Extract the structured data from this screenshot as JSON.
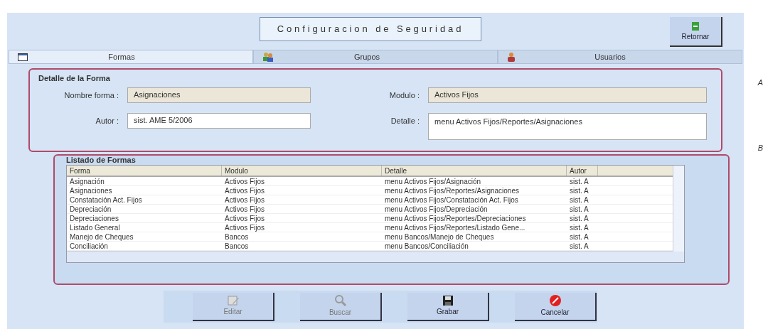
{
  "header": {
    "title": "Configuracion de Seguridad",
    "return_button": "Retornar"
  },
  "tabs": [
    {
      "label": "Formas",
      "selected": true,
      "kind": "form"
    },
    {
      "label": "Grupos",
      "selected": false,
      "kind": "group"
    },
    {
      "label": "Usuarios",
      "selected": false,
      "kind": "user"
    }
  ],
  "detail": {
    "title": "Detalle de la Forma",
    "fields": [
      {
        "label": "Nombre forma :",
        "value": "Asignaciones",
        "disabled": true
      },
      {
        "label": "Modulo :",
        "value": "Activos Fijos",
        "disabled": true
      },
      {
        "label": "Autor :",
        "value": "sist. AME 5/2006",
        "disabled": false
      },
      {
        "label": "Detalle :",
        "value": "menu Activos Fijos/Reportes/Asignaciones",
        "disabled": false
      }
    ]
  },
  "listing": {
    "title": "Listado de Formas",
    "columns": [
      "Forma",
      "Modulo",
      "Detalle",
      "Autor"
    ],
    "rows": [
      [
        "Asignación",
        "Activos Fijos",
        "menu Activos Fijos/Asignación",
        "sist. A"
      ],
      [
        "Asignaciones",
        "Activos Fijos",
        "menu Activos Fijos/Reportes/Asignaciones",
        "sist. A"
      ],
      [
        "Constatación Act. Fijos",
        "Activos Fijos",
        "menu Activos Fijos/Constatación Act. Fijos",
        "sist. A"
      ],
      [
        "Depreciación",
        "Activos Fijos",
        "menu Activos Fijos/Depreciación",
        "sist. A"
      ],
      [
        "Depreciaciones",
        "Activos Fijos",
        "menu Activos Fijos/Reportes/Depreciaciones",
        "sist. A"
      ],
      [
        "Listado General",
        "Activos Fijos",
        "menu Activos Fijos/Reportes/Listado Gene...",
        "sist. A"
      ],
      [
        "Manejo de Cheques",
        "Bancos",
        "menu Bancos/Manejo de Cheques",
        "sist. A"
      ],
      [
        "Conciliación",
        "Bancos",
        "menu Bancos/Conciliación",
        "sist. A"
      ]
    ]
  },
  "buttons": [
    {
      "label": "Editar",
      "kind": "edit",
      "disabled": true
    },
    {
      "label": "Buscar",
      "kind": "search",
      "disabled": true
    },
    {
      "label": "Grabar",
      "kind": "save",
      "disabled": false
    },
    {
      "label": "Cancelar",
      "kind": "cancel",
      "disabled": false
    }
  ],
  "annotations": [
    "A",
    "B"
  ]
}
